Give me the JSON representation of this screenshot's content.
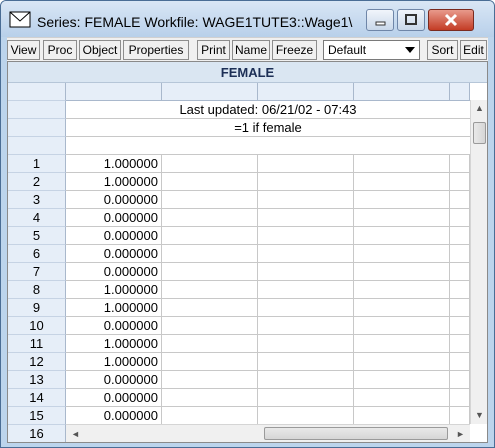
{
  "window": {
    "title": "Series: FEMALE   Workfile: WAGE1TUTE3::Wage1\\"
  },
  "toolbar": {
    "buttons": [
      "View",
      "Proc",
      "Object",
      "Properties",
      "Print",
      "Name",
      "Freeze",
      "Sort",
      "Edit"
    ],
    "dropdown_value": "Default"
  },
  "sheet": {
    "series_name": "FEMALE",
    "last_updated": "Last updated: 06/21/02 - 07:43",
    "description": "=1 if female",
    "rows": [
      {
        "n": "1",
        "v": "1.000000"
      },
      {
        "n": "2",
        "v": "1.000000"
      },
      {
        "n": "3",
        "v": "0.000000"
      },
      {
        "n": "4",
        "v": "0.000000"
      },
      {
        "n": "5",
        "v": "0.000000"
      },
      {
        "n": "6",
        "v": "0.000000"
      },
      {
        "n": "7",
        "v": "0.000000"
      },
      {
        "n": "8",
        "v": "1.000000"
      },
      {
        "n": "9",
        "v": "1.000000"
      },
      {
        "n": "10",
        "v": "0.000000"
      },
      {
        "n": "11",
        "v": "1.000000"
      },
      {
        "n": "12",
        "v": "1.000000"
      },
      {
        "n": "13",
        "v": "0.000000"
      },
      {
        "n": "14",
        "v": "0.000000"
      },
      {
        "n": "15",
        "v": "0.000000"
      },
      {
        "n": "16",
        "v": ""
      }
    ]
  },
  "icons": {
    "window": "series-envelope-icon",
    "minimize": "minimize-icon",
    "maximize": "maximize-icon",
    "close": "close-icon"
  }
}
